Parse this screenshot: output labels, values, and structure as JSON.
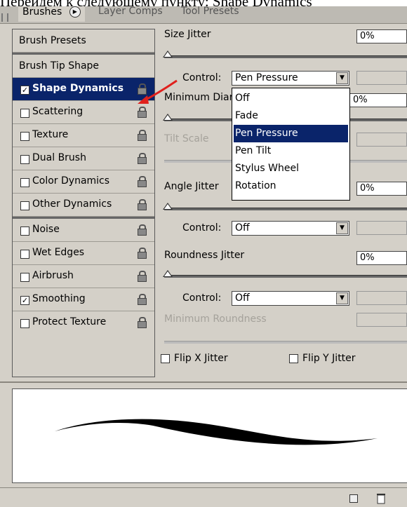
{
  "caption": "Перейдем к следующему пункту: Shape Dynamics",
  "tabs": [
    {
      "label": "Brushes",
      "active": true
    },
    {
      "label": "Layer Comps",
      "active": false
    },
    {
      "label": "Tool Presets",
      "active": false
    }
  ],
  "left_panel": {
    "items": [
      {
        "label": "Brush Presets"
      },
      {
        "label": "Brush Tip Shape"
      },
      {
        "label": "Shape Dynamics",
        "checked": true,
        "selected": true
      },
      {
        "label": "Scattering",
        "checked": false
      },
      {
        "label": "Texture",
        "checked": false
      },
      {
        "label": "Dual Brush",
        "checked": false
      },
      {
        "label": "Color Dynamics",
        "checked": false
      },
      {
        "label": "Other Dynamics",
        "checked": false
      },
      {
        "label": "Noise",
        "checked": false
      },
      {
        "label": "Wet Edges",
        "checked": false
      },
      {
        "label": "Airbrush",
        "checked": false
      },
      {
        "label": "Smoothing",
        "checked": true
      },
      {
        "label": "Protect Texture",
        "checked": false
      }
    ]
  },
  "right_panel": {
    "size_jitter_label": "Size Jitter",
    "size_jitter_value": "0%",
    "control_label": "Control:",
    "control1_value": "Pen Pressure",
    "min_diameter_label": "Minimum Diar",
    "min_diameter_value": "0%",
    "tilt_scale_label": "Tilt Scale",
    "angle_jitter_label": "Angle Jitter",
    "angle_jitter_value": "0%",
    "control2_value": "Off",
    "roundness_jitter_label": "Roundness Jitter",
    "roundness_jitter_value": "0%",
    "control3_value": "Off",
    "min_roundness_label": "Minimum Roundness",
    "flip_x_label": "Flip X Jitter",
    "flip_y_label": "Flip Y Jitter"
  },
  "dropdown": {
    "options": [
      "Off",
      "Fade",
      "Pen Pressure",
      "Pen Tilt",
      "Stylus Wheel",
      "Rotation"
    ],
    "highlighted": "Pen Pressure"
  },
  "colors": {
    "selection": "#0a246a",
    "panel_bg": "#d4d0c8",
    "annotation_arrow": "#e0201c"
  },
  "icons": [
    "lock-icon",
    "panel-menu-icon",
    "new-preset-icon",
    "trash-icon"
  ]
}
